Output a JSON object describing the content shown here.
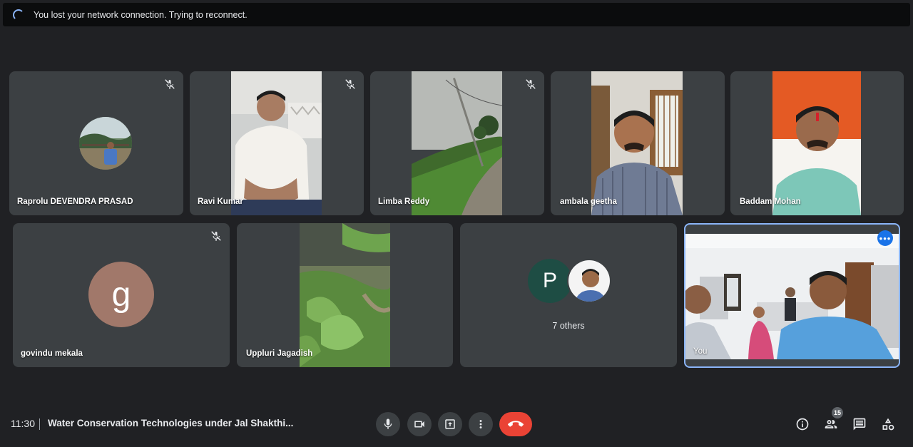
{
  "banner": {
    "message": "You lost your network connection. Trying to reconnect."
  },
  "participants": [
    {
      "name": "Raprolu DEVENDRA PRASAD",
      "muted": true,
      "mode": "photo-avatar"
    },
    {
      "name": "Ravi Kumar",
      "muted": true,
      "mode": "video"
    },
    {
      "name": "Limba Reddy",
      "muted": true,
      "mode": "video"
    },
    {
      "name": "ambala geetha",
      "muted": false,
      "mode": "video"
    },
    {
      "name": "Baddam Mohan",
      "muted": false,
      "mode": "video"
    },
    {
      "name": "govindu mekala",
      "muted": true,
      "mode": "letter-avatar",
      "initial": "g",
      "avatar_color": "#a1786a"
    },
    {
      "name": "Uppluri Jagadish",
      "muted": false,
      "mode": "video"
    }
  ],
  "others": {
    "initial": "P",
    "avatar_color": "#1e4d44",
    "label": "7 others"
  },
  "self": {
    "label": "You",
    "more_icon": "more-horizontal-icon"
  },
  "bottom_bar": {
    "time": "11:30",
    "meeting_title": "Water Conservation Technologies under Jal Shakthi...",
    "people_count": "15",
    "end_call_color": "#ea4335",
    "accent_color": "#8ab4f8"
  },
  "controls": {
    "mic": "microphone-icon",
    "camera": "video-camera-icon",
    "present": "present-screen-icon",
    "more": "more-vertical-icon",
    "end": "end-call-icon",
    "info": "info-icon",
    "people": "people-icon",
    "chat": "chat-icon",
    "activities": "activities-icon"
  }
}
